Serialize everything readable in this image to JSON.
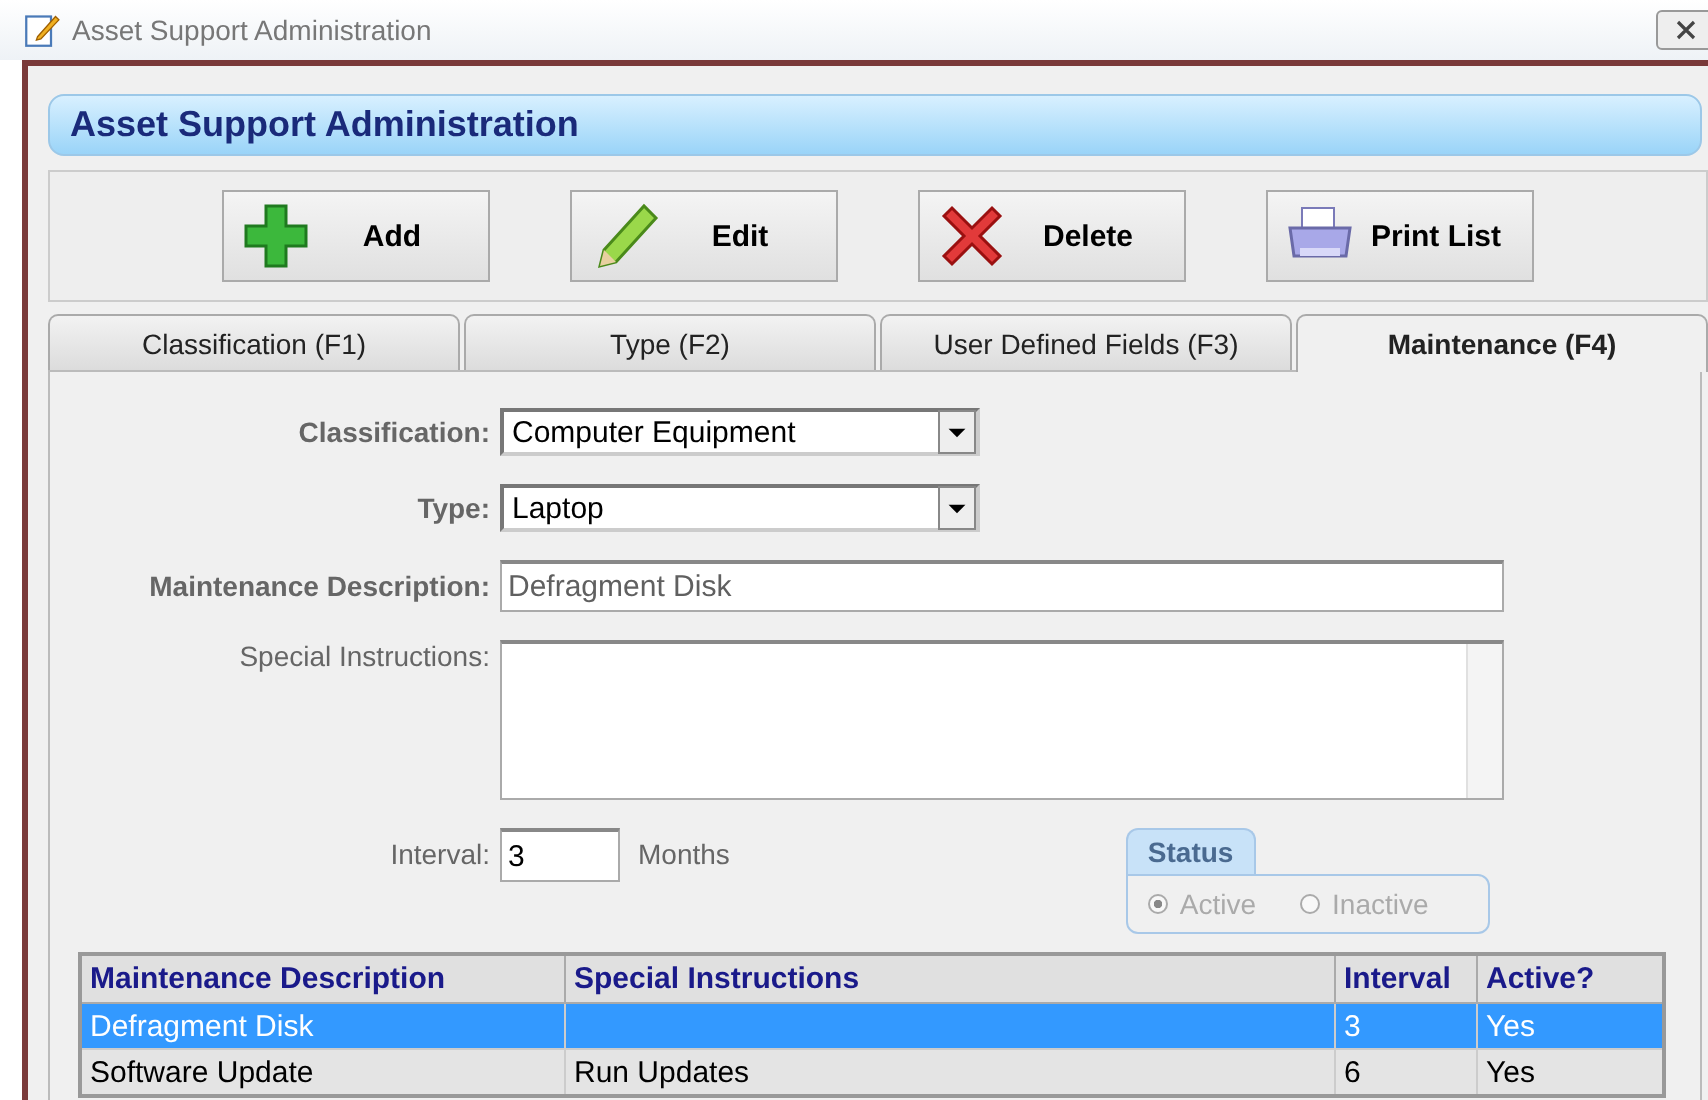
{
  "window": {
    "title": "Asset Support Administration"
  },
  "header": {
    "title": "Asset Support Administration"
  },
  "toolbar": [
    {
      "label": "Add",
      "kind": "add"
    },
    {
      "label": "Edit",
      "kind": "edit"
    },
    {
      "label": "Delete",
      "kind": "delete"
    },
    {
      "label": "Print List",
      "kind": "print"
    }
  ],
  "tabs": [
    {
      "label": "Classification (F1)",
      "selected": false
    },
    {
      "label": "Type (F2)",
      "selected": false
    },
    {
      "label": "User Defined Fields (F3)",
      "selected": false
    },
    {
      "label": "Maintenance (F4)",
      "selected": true
    }
  ],
  "form": {
    "classification": {
      "label": "Classification:",
      "value": "Computer Equipment"
    },
    "type": {
      "label": "Type:",
      "value": "Laptop"
    },
    "maintenance_description": {
      "label": "Maintenance Description:",
      "value": "Defragment Disk"
    },
    "special_instructions": {
      "label": "Special Instructions:"
    },
    "interval": {
      "label": "Interval:",
      "value": "3",
      "unit": "Months"
    },
    "status": {
      "title": "Status",
      "options": [
        {
          "label": "Active",
          "selected": true
        },
        {
          "label": "Inactive",
          "selected": false
        }
      ]
    }
  },
  "table": {
    "columns": [
      "Maintenance Description",
      "Special Instructions",
      "Interval",
      "Active?"
    ],
    "rows": [
      {
        "cells": [
          "Defragment Disk",
          "",
          "3",
          "Yes"
        ],
        "selected": true
      },
      {
        "cells": [
          "Software Update",
          "Run Updates",
          "6",
          "Yes"
        ],
        "selected": false
      }
    ]
  }
}
